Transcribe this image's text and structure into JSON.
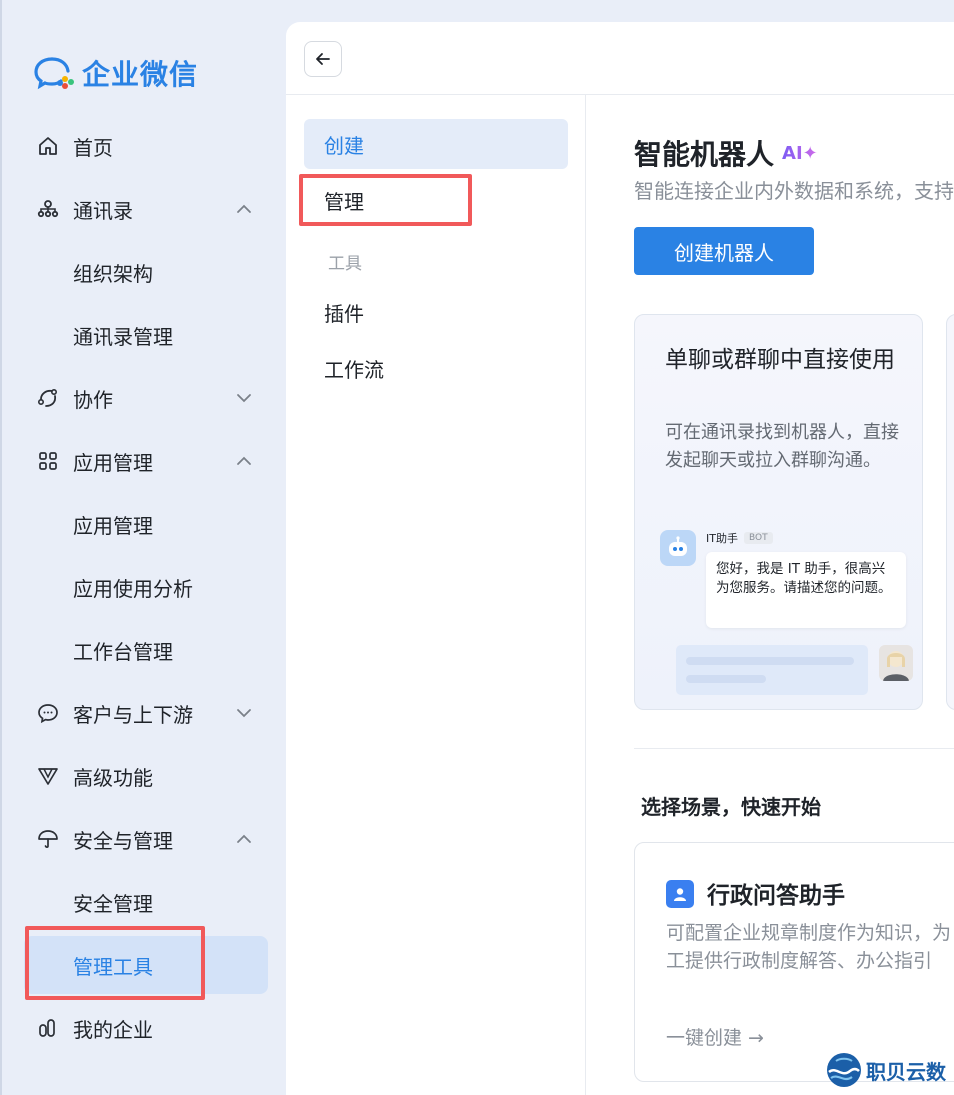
{
  "logo": {
    "text": "企业微信"
  },
  "sidebar": {
    "items": [
      {
        "label": "首页",
        "icon": "home-icon"
      },
      {
        "label": "通讯录",
        "icon": "org-icon",
        "expanded": true
      },
      {
        "label": "组织架构"
      },
      {
        "label": "通讯录管理"
      },
      {
        "label": "协作",
        "icon": "collab-icon",
        "expanded": false
      },
      {
        "label": "应用管理",
        "icon": "apps-icon",
        "expanded": true
      },
      {
        "label": "应用管理"
      },
      {
        "label": "应用使用分析"
      },
      {
        "label": "工作台管理"
      },
      {
        "label": "客户与上下游",
        "icon": "chat-icon",
        "expanded": false
      },
      {
        "label": "高级功能",
        "icon": "advanced-icon"
      },
      {
        "label": "安全与管理",
        "icon": "umbrella-icon",
        "expanded": true
      },
      {
        "label": "安全管理"
      },
      {
        "label": "管理工具",
        "active": true
      },
      {
        "label": "我的企业",
        "icon": "building-icon"
      }
    ]
  },
  "subnav": {
    "create": "创建",
    "manage": "管理",
    "tools_group": "工具",
    "plugins": "插件",
    "workflow": "工作流"
  },
  "content": {
    "title": "智能机器人",
    "ai_badge": "AI✦",
    "subtitle": "智能连接企业内外数据和系统，支持",
    "create_button": "创建机器人",
    "card1": {
      "title": "单聊或群聊中直接使用",
      "desc": "可在通讯录找到机器人，直接发起聊天或拉入群聊沟通。",
      "bot_name": "IT助手",
      "bot_tag": "BOT",
      "bubble": "您好，我是 IT 助手，很高兴为您服务。请描述您的问题。"
    },
    "section_title": "选择场景，快速开始",
    "card2": {
      "title": "行政问答助手",
      "desc_line1": "可配置企业规章制度作为知识，为",
      "desc_line2": "工提供行政制度解答、办公指引",
      "link": "一键创建 →"
    }
  },
  "watermark": {
    "text": "职贝云数"
  },
  "colors": {
    "accent": "#2a82e4",
    "highlight_box": "#f1595a",
    "sidebar_bg": "#e9eef8"
  }
}
